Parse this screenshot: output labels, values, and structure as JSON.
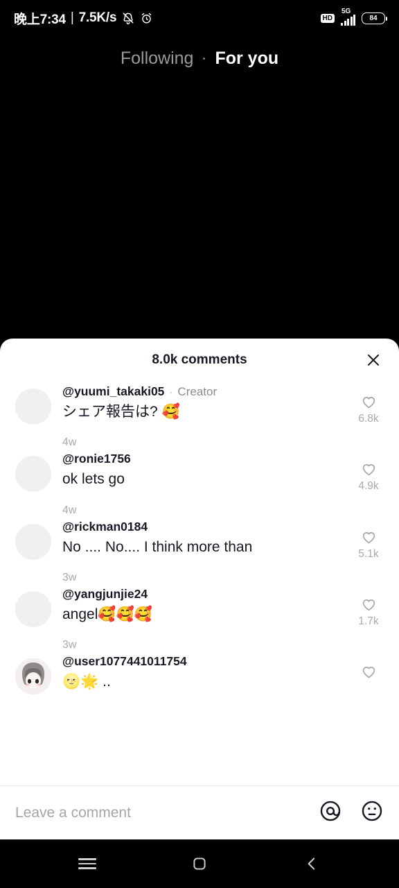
{
  "status_bar": {
    "time": "晚上7:34",
    "divider": "|",
    "network_speed": "7.5K/s",
    "mute_icon": "bell-muted-icon",
    "alarm_icon": "alarm-clock-icon",
    "hd_label": "HD",
    "network_type": "5G",
    "battery_level": "84"
  },
  "top_tabs": {
    "following": "Following",
    "for_you": "For you"
  },
  "comments_sheet": {
    "title": "8.0k comments",
    "close_icon": "close-icon",
    "comments": [
      {
        "username": "@yuumi_takaki05",
        "separator": "·",
        "badge": "Creator",
        "text": "シェア報告は? 🥰",
        "time": "4w",
        "likes": "6.8k"
      },
      {
        "username": "@ronie1756",
        "separator": "",
        "badge": "",
        "text": "ok lets go",
        "time": "4w",
        "likes": "4.9k"
      },
      {
        "username": "@rickman0184",
        "separator": "",
        "badge": "",
        "text": "No .... No.... I think more than",
        "time": "3w",
        "likes": "5.1k"
      },
      {
        "username": "@yangjunjie24",
        "separator": "",
        "badge": "",
        "text": "angel🥰🥰🥰",
        "time": "3w",
        "likes": "1.7k"
      },
      {
        "username": "@user1077441011754",
        "separator": "",
        "badge": "",
        "text": "🌝🌟 ..",
        "time": "",
        "likes": ""
      }
    ]
  },
  "comment_input": {
    "placeholder": "Leave a comment",
    "mention_icon": "at-mention-icon",
    "emoji_icon": "emoji-face-icon"
  },
  "nav_bar": {
    "recents_icon": "recents-icon",
    "home_icon": "home-icon",
    "back_icon": "back-icon"
  },
  "colors": {
    "background": "#000000",
    "sheet": "#ffffff",
    "text_primary": "#161823",
    "text_muted": "#a8a8ad",
    "avatar_placeholder": "#f0f0f0"
  }
}
